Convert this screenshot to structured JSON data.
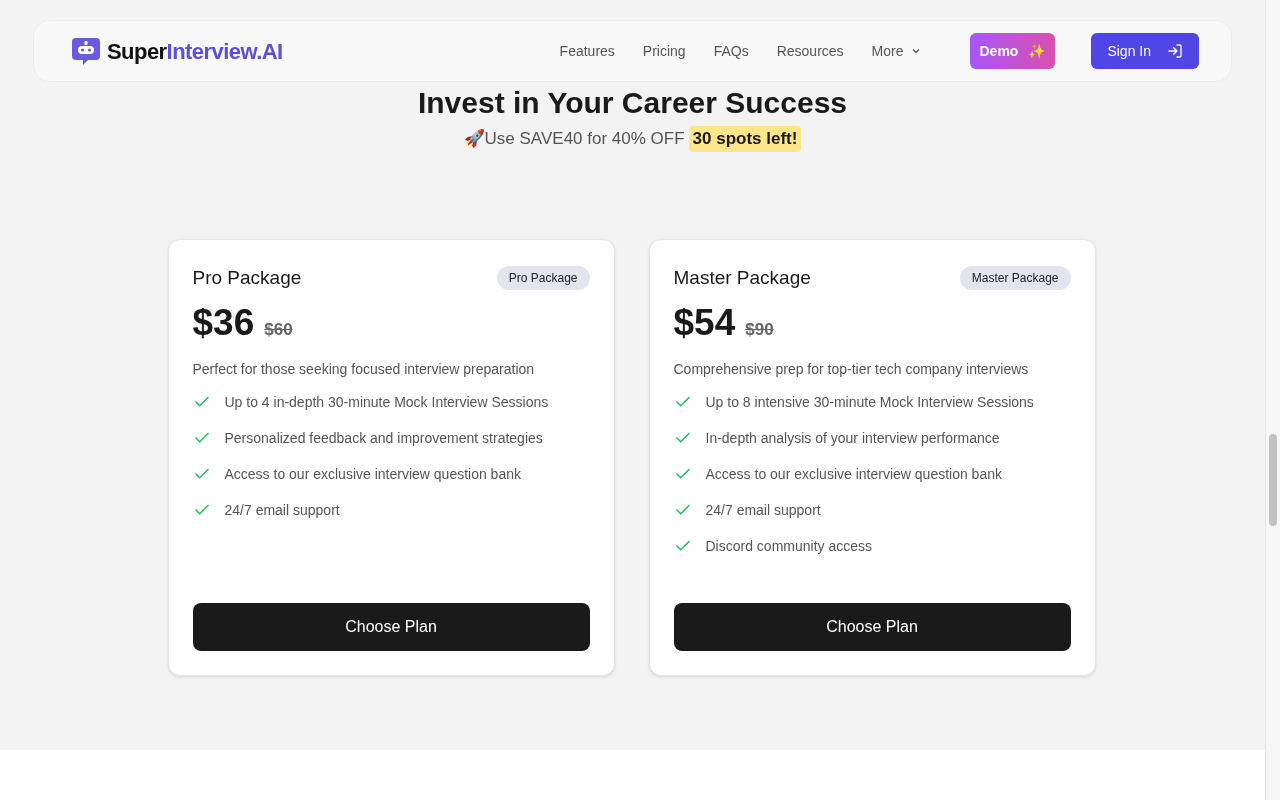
{
  "nav": {
    "logo": {
      "part1": "Super",
      "part2": "Interview.AI"
    },
    "links": [
      {
        "label": "Features",
        "kind": "link"
      },
      {
        "label": "Pricing",
        "kind": "link"
      },
      {
        "label": "FAQs",
        "kind": "link"
      },
      {
        "label": "Resources",
        "kind": "link"
      },
      {
        "label": "More",
        "kind": "dropdown"
      }
    ],
    "demo": {
      "label": "Demo",
      "icon": "✨"
    },
    "sign_in": {
      "label": "Sign In"
    }
  },
  "hero": {
    "title": "Invest in Your Career Success",
    "promo": "🚀Use SAVE40 for 40% OFF",
    "highlight": "30 spots left!"
  },
  "plans": [
    {
      "name": "Pro Package",
      "badge": "Pro Package",
      "price": "$36",
      "old_price": "$60",
      "description": "Perfect for those seeking focused interview preparation",
      "features": [
        "Up to 4 in-depth 30-minute Mock Interview Sessions",
        "Personalized feedback and improvement strategies",
        "Access to our exclusive interview question bank",
        "24/7 email support"
      ],
      "button": "Choose Plan"
    },
    {
      "name": "Master Package",
      "badge": "Master Package",
      "price": "$54",
      "old_price": "$90",
      "description": "Comprehensive prep for top-tier tech company interviews",
      "features": [
        "Up to 8 intensive 30-minute Mock Interview Sessions",
        "In-depth analysis of your interview performance",
        "Access to our exclusive interview question bank",
        "24/7 email support",
        "Discord community access"
      ],
      "button": "Choose Plan"
    }
  ]
}
